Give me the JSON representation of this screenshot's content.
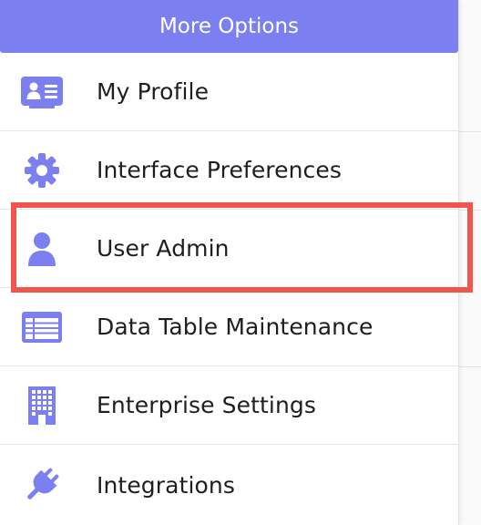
{
  "menu": {
    "title": "More Options",
    "items": [
      {
        "label": "My Profile",
        "icon": "id-card-icon"
      },
      {
        "label": "Interface Preferences",
        "icon": "gear-icon"
      },
      {
        "label": "User Admin",
        "icon": "user-icon",
        "highlighted": true
      },
      {
        "label": "Data Table Maintenance",
        "icon": "table-icon"
      },
      {
        "label": "Enterprise Settings",
        "icon": "building-icon"
      },
      {
        "label": "Integrations",
        "icon": "plug-icon"
      }
    ]
  },
  "colors": {
    "header_bg": "#7b7fef",
    "icon": "#7b7fef",
    "highlight_border": "#f2554c"
  }
}
